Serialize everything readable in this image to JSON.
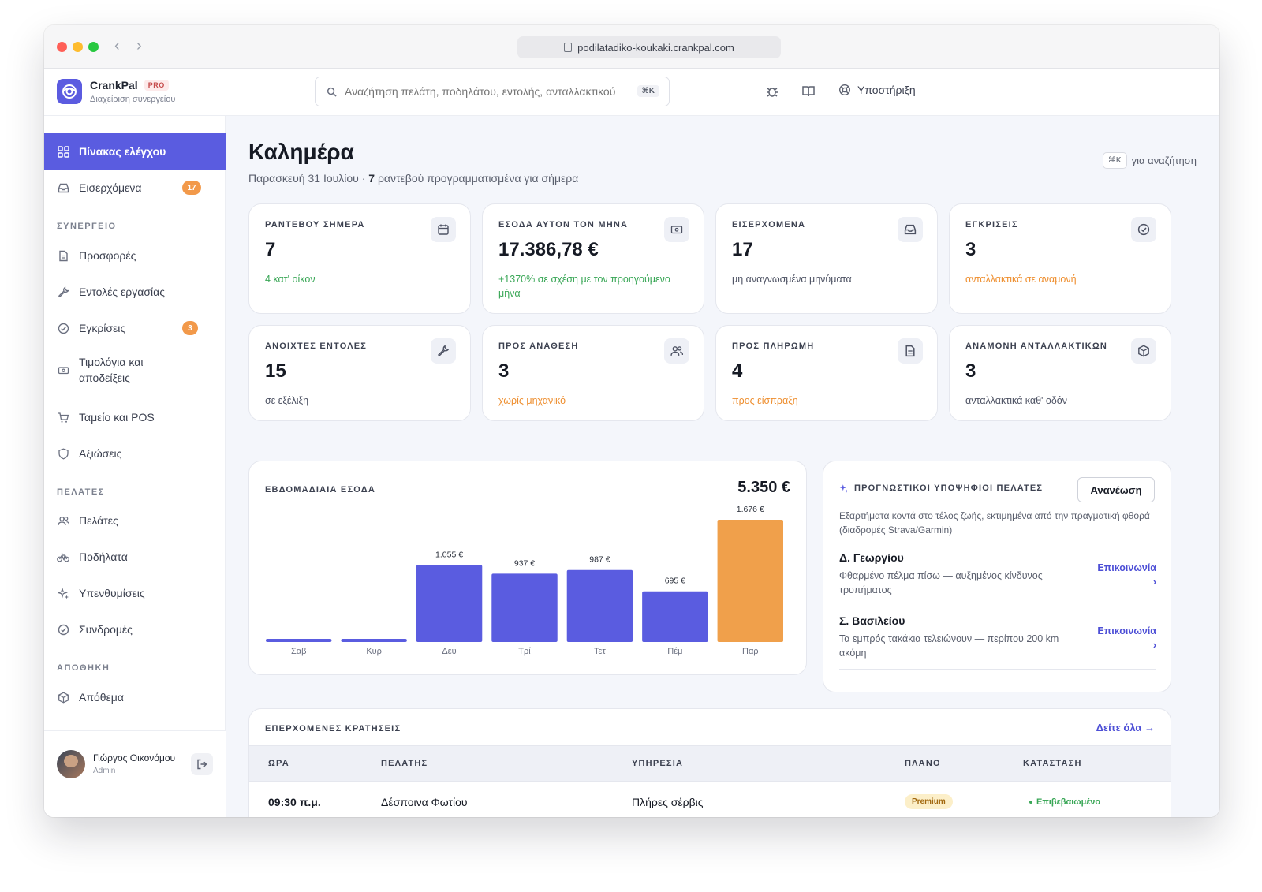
{
  "browser": {
    "url": "podilatadiko-koukaki.crankpal.com"
  },
  "header": {
    "brand": "CrankPal",
    "plan_badge": "PRO",
    "brand_subtitle": "Διαχείριση συνεργείου",
    "search_placeholder": "Αναζήτηση πελάτη, ποδηλάτου, εντολής, ανταλλακτικού",
    "search_shortcut": "⌘K",
    "support_label": "Υποστήριξη"
  },
  "sidebar": {
    "top_items": [
      {
        "label": "Πίνακας ελέγχου",
        "icon": "grid-icon"
      },
      {
        "label": "Εισερχόμενα",
        "icon": "inbox-icon",
        "badge": "17"
      }
    ],
    "sections": [
      {
        "title": "ΣΥΝΕΡΓΕΙΟ",
        "items": [
          {
            "label": "Προσφορές",
            "icon": "document-icon"
          },
          {
            "label": "Εντολές εργασίας",
            "icon": "wrench-icon"
          },
          {
            "label": "Εγκρίσεις",
            "icon": "check-circle-icon",
            "badge": "3"
          },
          {
            "label": "Τιμολόγια και αποδείξεις",
            "icon": "banknote-icon"
          },
          {
            "label": "Ταμείο και POS",
            "icon": "cart-icon"
          },
          {
            "label": "Αξιώσεις",
            "icon": "shield-icon"
          }
        ]
      },
      {
        "title": "ΠΕΛΑΤΕΣ",
        "items": [
          {
            "label": "Πελάτες",
            "icon": "users-icon"
          },
          {
            "label": "Ποδήλατα",
            "icon": "bicycle-icon"
          },
          {
            "label": "Υπενθυμίσεις",
            "icon": "sparkles-icon"
          },
          {
            "label": "Συνδρομές",
            "icon": "check-circle-icon"
          }
        ]
      },
      {
        "title": "ΑΠΟΘΗΚΗ",
        "items": [
          {
            "label": "Απόθεμα",
            "icon": "box-icon"
          }
        ]
      }
    ],
    "user": {
      "name": "Γιώργος Οικονόμου",
      "role": "Admin"
    }
  },
  "main": {
    "greeting": "Καλημέρα",
    "date": "Παρασκευή 31 Ιουλίου · ",
    "appointments_count": "7",
    "appointments_text": " ραντεβού προγραμματισμένα για σήμερα",
    "search_hint_key": "⌘K",
    "search_hint_text": "για αναζήτηση",
    "stats": [
      {
        "title": "ΡΑΝΤΕΒΟΥ ΣΗΜΕΡΑ",
        "value": "7",
        "note": "4 κατ' οίκον",
        "tone": "green",
        "icon": "calendar-icon"
      },
      {
        "title": "ΕΣΟΔΑ ΑΥΤΟΝ ΤΟΝ ΜΗΝΑ",
        "value": "17.386,78 €",
        "note": "+1370% σε σχέση με τον προηγούμενο μήνα",
        "tone": "green",
        "icon": "banknote-icon"
      },
      {
        "title": "ΕΙΣΕΡΧΟΜΕΝΑ",
        "value": "17",
        "note": "μη αναγνωσμένα μηνύματα",
        "tone": "grey",
        "icon": "inbox-icon"
      },
      {
        "title": "ΕΓΚΡΙΣΕΙΣ",
        "value": "3",
        "note": "ανταλλακτικά σε αναμονή",
        "tone": "orange",
        "icon": "check-circle-icon"
      },
      {
        "title": "ΑΝΟΙΧΤΕΣ ΕΝΤΟΛΕΣ",
        "value": "15",
        "note": "σε εξέλιξη",
        "tone": "grey",
        "icon": "wrench-icon"
      },
      {
        "title": "ΠΡΟΣ ΑΝΑΘΕΣΗ",
        "value": "3",
        "note": "χωρίς μηχανικό",
        "tone": "orange",
        "icon": "users-icon"
      },
      {
        "title": "ΠΡΟΣ ΠΛΗΡΩΜΗ",
        "value": "4",
        "note": "προς είσπραξη",
        "tone": "orange",
        "icon": "document-icon"
      },
      {
        "title": "ΑΝΑΜΟΝΗ ΑΝΤΑΛΛΑΚΤΙΚΩΝ",
        "value": "3",
        "note": "ανταλλακτικά καθ' οδόν",
        "tone": "grey",
        "icon": "box-icon"
      }
    ],
    "weekly_title": "ΕΒΔΟΜΑΔΙΑΙΑ ΕΣΟΔΑ",
    "weekly_total": "5.350 €",
    "predictive": {
      "title": "ΠΡΟΓΝΩΣΤΙΚΟΙ ΥΠΟΨΗΦΙΟΙ ΠΕΛΑΤΕΣ",
      "refresh_label": "Ανανέωση",
      "description": "Εξαρτήματα κοντά στο τέλος ζωής, εκτιμημένα από την πραγματική φθορά (διαδρομές Strava/Garmin)",
      "rows": [
        {
          "name": "Δ. Γεωργίου",
          "text": "Φθαρμένο πέλμα πίσω — αυξημένος κίνδυνος τρυπήματος",
          "link": "Επικοινωνία ›"
        },
        {
          "name": "Σ. Βασιλείου",
          "text": "Τα εμπρός τακάκια τελειώνουν — περίπου 200 km ακόμη",
          "link": "Επικοινωνία ›"
        }
      ]
    },
    "bookings": {
      "title": "ΕΠΕΡΧΟΜΕΝΕΣ ΚΡΑΤΗΣΕΙΣ",
      "view_all": "Δείτε όλα →",
      "columns": [
        "ΩΡΑ",
        "ΠΕΛΑΤΗΣ",
        "ΥΠΗΡΕΣΙΑ",
        "ΠΛΑΝΟ",
        "ΚΑΤΑΣΤΑΣΗ"
      ],
      "rows": [
        {
          "time": "09:30 π.μ.",
          "customer": "Δέσποινα Φωτίου",
          "service": "Πλήρες σέρβις",
          "plan": "Premium",
          "status": "Επιβεβαιωμένο"
        }
      ]
    }
  },
  "chart_data": {
    "type": "bar",
    "title": "ΕΒΔΟΜΑΔΙΑΙΑ ΕΣΟΔΑ",
    "categories": [
      "Σαβ",
      "Κυρ",
      "Δευ",
      "Τρί",
      "Τετ",
      "Πέμ",
      "Παρ"
    ],
    "values": [
      0,
      0,
      1055,
      937,
      987,
      695,
      1676
    ],
    "value_labels": [
      "",
      "",
      "1.055 €",
      "937 €",
      "987 €",
      "695 €",
      "1.676 €"
    ],
    "highlight_index": 6,
    "colors": {
      "bar": "#5a5ce0",
      "highlight": "#f0a04b"
    },
    "ylim": [
      0,
      1676
    ]
  }
}
